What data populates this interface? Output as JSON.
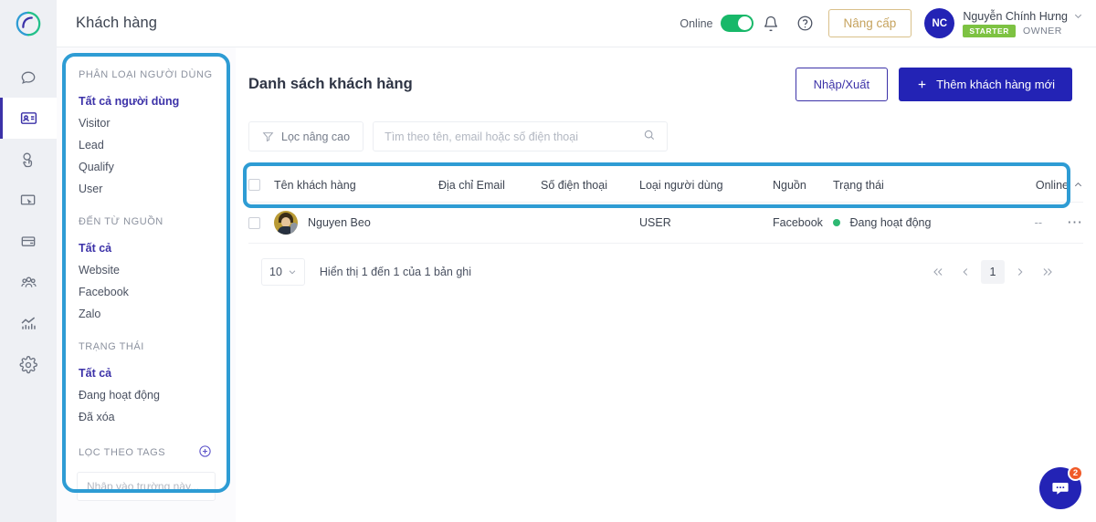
{
  "app": {
    "logo_icon": "subiz-swirl-logo",
    "page_title": "Khách hàng"
  },
  "topbar": {
    "online_label": "Online",
    "online_toggle_on": true,
    "bell_icon": "bell-icon",
    "help_icon": "question-circle-icon",
    "upgrade_label": "Nâng cấp",
    "upgrade_color": "#c6a35e",
    "user": {
      "initials": "NC",
      "name": "Nguyễn Chính Hưng",
      "plan_badge": "STARTER",
      "plan_badge_color": "#7dc242",
      "role": "OWNER",
      "caret_icon": "chevron-down-icon"
    }
  },
  "rail": {
    "items": [
      {
        "icon": "chat-bubble-icon",
        "active": false
      },
      {
        "icon": "contact-card-icon",
        "active": true
      },
      {
        "icon": "hand-pointer-icon",
        "active": false
      },
      {
        "icon": "screen-cursor-icon",
        "active": false
      },
      {
        "icon": "window-card-icon",
        "active": false
      },
      {
        "icon": "people-group-icon",
        "active": false
      },
      {
        "icon": "analytics-chart-icon",
        "active": false
      },
      {
        "icon": "gear-icon",
        "active": false
      }
    ],
    "active_color": "#3c32a8"
  },
  "filter_sidebar": {
    "highlight_color": "#2e9cd4",
    "groups": [
      {
        "title": "PHÂN LOẠI NGƯỜI DÙNG",
        "items": [
          {
            "label": "Tất cả người dùng",
            "selected": true
          },
          {
            "label": "Visitor",
            "selected": false
          },
          {
            "label": "Lead",
            "selected": false
          },
          {
            "label": "Qualify",
            "selected": false
          },
          {
            "label": "User",
            "selected": false
          }
        ]
      },
      {
        "title": "ĐẾN TỪ NGUỒN",
        "items": [
          {
            "label": "Tất cả",
            "selected": true
          },
          {
            "label": "Website",
            "selected": false
          },
          {
            "label": "Facebook",
            "selected": false
          },
          {
            "label": "Zalo",
            "selected": false
          }
        ]
      },
      {
        "title": "TRẠNG THÁI",
        "items": [
          {
            "label": "Tất cả",
            "selected": true
          },
          {
            "label": "Đang hoạt động",
            "selected": false
          },
          {
            "label": "Đã xóa",
            "selected": false
          }
        ]
      }
    ],
    "tags": {
      "title": "LỌC THEO TAGS",
      "add_icon": "plus-circle-icon",
      "input_placeholder": "Nhập vào trường này..."
    }
  },
  "main": {
    "title": "Danh sách khách hàng",
    "import_export_label": "Nhập/Xuất",
    "add_customer_label": "Thêm khách hàng mới",
    "add_icon": "plus-icon",
    "toolbar": {
      "advanced_filter_label": "Lọc nâng cao",
      "filter_icon": "funnel-icon",
      "search_placeholder": "Tìm theo tên, email hoặc số điện thoại",
      "search_value": "",
      "search_icon": "search-icon"
    },
    "table": {
      "highlight_color": "#2e9cd4",
      "columns": [
        "Tên khách hàng",
        "Địa chỉ Email",
        "Số điện thoại",
        "Loại người dùng",
        "Nguồn",
        "Trạng thái",
        "Online"
      ],
      "sort_column": "Online",
      "sort_icon": "chevron-up-icon",
      "rows": [
        {
          "avatar": "user-photo-avatar",
          "name": "Nguyen Beo",
          "email": "",
          "phone": "",
          "type": "USER",
          "source": "Facebook",
          "status": "Đang hoạt động",
          "status_dot_color": "#2eb872",
          "online": "--",
          "menu_icon": "ellipsis-icon"
        }
      ]
    },
    "pagination": {
      "per_page": "10",
      "per_page_icon": "chevron-down-icon",
      "showing_text": "Hiển thị 1 đến 1 của 1 bản ghi",
      "first_icon": "double-chevron-left-icon",
      "prev_icon": "chevron-left-icon",
      "current_page": "1",
      "next_icon": "chevron-right-icon",
      "last_icon": "double-chevron-right-icon"
    }
  },
  "chat_widget": {
    "icon": "chat-dots-icon",
    "unread_count": "2",
    "color": "#2323b5",
    "badge_color": "#f05a28"
  }
}
